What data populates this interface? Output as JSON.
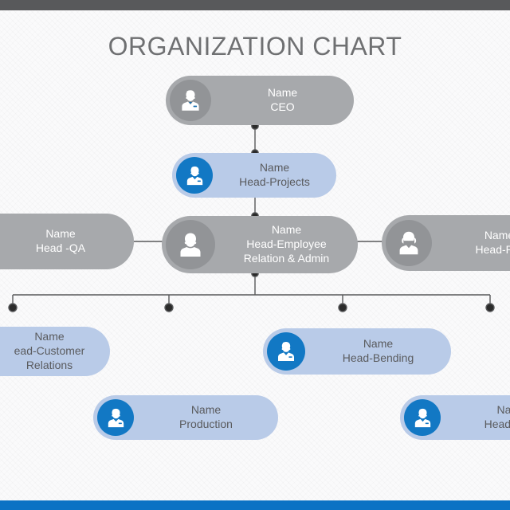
{
  "slide": {
    "title": "ORGANIZATION CHART",
    "title_color": "#6f7072",
    "background_color": "#fafafb",
    "top_bar_color": "#58595b",
    "bottom_bar_color": "#0b72c4",
    "gray_node_color": "#a7a9ac",
    "gray_badge_color": "#929497",
    "blue_node_color": "#b9cbe8",
    "blue_badge_color": "#1278c4",
    "connector_color": "#58595b"
  },
  "nodes": {
    "ceo": {
      "name": "Name",
      "role": "CEO",
      "role2": "",
      "style": "gray",
      "icon": "person-tie-icon"
    },
    "projects": {
      "name": "Name",
      "role": "Head-Projects",
      "role2": "",
      "style": "blue",
      "icon": "person-tie-icon"
    },
    "qa": {
      "name": "Name",
      "role": "Head -QA",
      "role2": "",
      "style": "gray",
      "icon": "none"
    },
    "admin": {
      "name": "Name",
      "role": "Head-Employee",
      "role2": "Relation & Admin",
      "style": "gray",
      "icon": "person-head-icon"
    },
    "procure": {
      "name": "Name",
      "role": "Head-Pro",
      "role2": "",
      "style": "gray",
      "icon": "person-female-icon"
    },
    "customer": {
      "name": "Name",
      "role": "ead-Customer",
      "role2": "Relations",
      "style": "blue",
      "icon": "none"
    },
    "bending": {
      "name": "Name",
      "role": "Head-Bending",
      "role2": "",
      "style": "blue",
      "icon": "person-tie-icon"
    },
    "production": {
      "name": "Name",
      "role": "Production",
      "role2": "",
      "style": "blue",
      "icon": "person-tie-icon"
    },
    "maintenance": {
      "name": "Na",
      "role": "Head-M",
      "role2": "",
      "style": "blue",
      "icon": "person-tie-icon"
    }
  },
  "chart_data": {
    "type": "diagram",
    "title": "ORGANIZATION CHART",
    "hierarchy": [
      {
        "id": "ceo",
        "label": "Name / CEO",
        "level": 0,
        "parent": null
      },
      {
        "id": "projects",
        "label": "Name / Head-Projects",
        "level": 1,
        "parent": "ceo"
      },
      {
        "id": "admin",
        "label": "Name / Head-Employee Relation & Admin",
        "level": 2,
        "parent": "projects"
      },
      {
        "id": "qa",
        "label": "Name / Head -QA",
        "level": 2,
        "parent": "admin"
      },
      {
        "id": "procure",
        "label": "Name / Head-Pro",
        "level": 2,
        "parent": "admin"
      },
      {
        "id": "customer",
        "label": "Name / Head-Customer Relations",
        "level": 3,
        "parent": "admin"
      },
      {
        "id": "production",
        "label": "Name / Production",
        "level": 3,
        "parent": "admin"
      },
      {
        "id": "bending",
        "label": "Name / Head-Bending",
        "level": 3,
        "parent": "admin"
      },
      {
        "id": "maintenance",
        "label": "Name / Head-M",
        "level": 3,
        "parent": "admin"
      }
    ]
  }
}
